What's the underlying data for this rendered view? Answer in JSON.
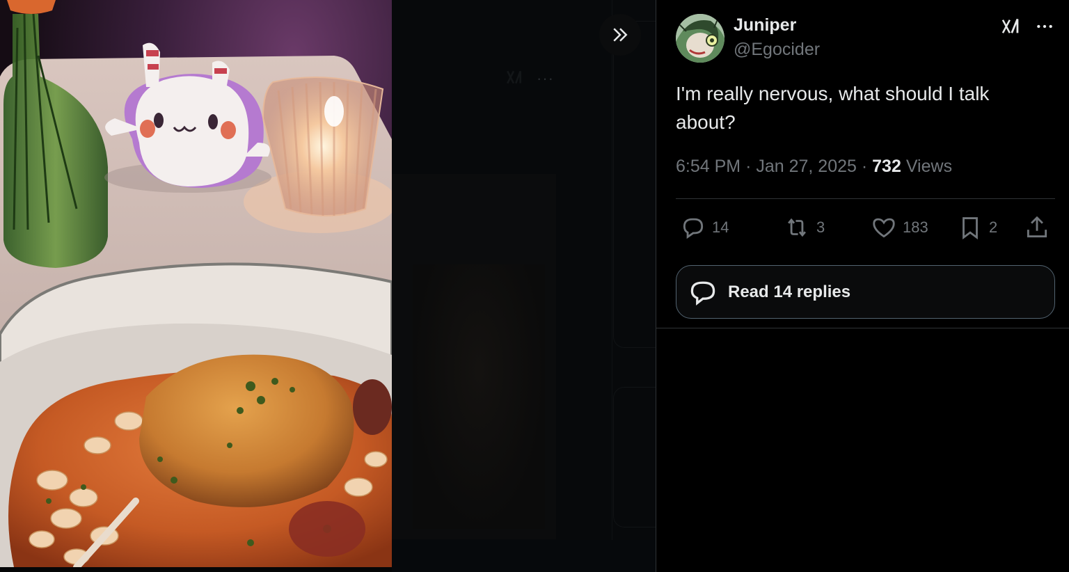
{
  "media": {
    "photo_alt": "Plush toy, candle, vase and plate of food on a dinner table"
  },
  "viewer": {
    "collapse_icon": "double-chevron-right-icon"
  },
  "tweet": {
    "author_name": "Juniper",
    "author_handle": "@Egocider",
    "text": "I'm really nervous, what should I talk about?",
    "time": "6:54 PM",
    "date": "Jan 27, 2025",
    "views_count": "732",
    "views_label": "Views",
    "separator": "·",
    "replies": "14",
    "reposts": "3",
    "likes": "183",
    "bookmarks": "2",
    "read_replies_label": "Read 14 replies"
  },
  "colors": {
    "background": "#000000",
    "text_primary": "#e7e9ea",
    "text_secondary": "#71767b",
    "border": "#2f3336"
  }
}
